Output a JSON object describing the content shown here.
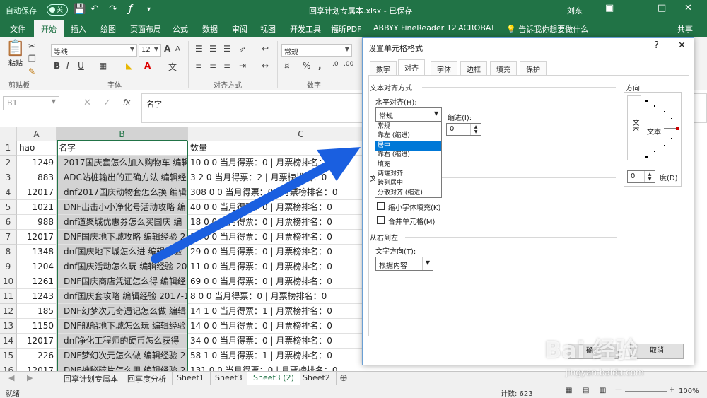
{
  "titlebar": {
    "autosave": "自动保存",
    "toggle": "关",
    "doc_title": "回享计划专属本.xlsx - 已保存",
    "user": "刘东",
    "icons": [
      "save-icon",
      "undo-icon",
      "redo-icon",
      "fx-icon",
      "customize-qat-icon"
    ]
  },
  "tabs": [
    "文件",
    "开始",
    "插入",
    "绘图",
    "页面布局",
    "公式",
    "数据",
    "审阅",
    "视图",
    "开发工具",
    "福昕PDF",
    "ABBYY FineReader 12",
    "ACROBAT"
  ],
  "tell_me": "告诉我你想要做什么",
  "share": "共享",
  "ribbon": {
    "paste": "粘贴",
    "clipboard": "剪贴板",
    "font_name": "等线",
    "font_size": "12",
    "font_group": "字体",
    "align_group": "对齐方式",
    "number_format": "常规",
    "number_group": "数字",
    "bold": "B",
    "italic": "I",
    "underline": "U",
    "font_a": "A",
    "wen": "文",
    "percent": "%",
    "comma": ","
  },
  "formula_bar": {
    "name_box": "B1",
    "fx": "fx",
    "content": "名字"
  },
  "grid": {
    "columns": [
      "A",
      "B",
      "C"
    ],
    "rows": [
      {
        "n": "1",
        "a": "hao",
        "b": "名字",
        "c": "数量"
      },
      {
        "n": "2",
        "a": "1249",
        "b": "2017国庆套怎么加入购物车 编辑",
        "c": "10 0 0 当月得票：0 | 月票榜排名：0"
      },
      {
        "n": "3",
        "a": "883",
        "b": "ADC站桩输出的正确方法 编辑经",
        "c": "3 2 0 当月得票：2 | 月票榜排名：0"
      },
      {
        "n": "4",
        "a": "12017",
        "b": "dnf2017国庆动物套怎么换 编辑",
        "c": "308 0 0 当月得票：0 | 月票榜排名：0"
      },
      {
        "n": "5",
        "a": "1021",
        "b": "DNF出击小小净化号活动攻略 编",
        "c": "40 0 0 当月得票：0 | 月票榜排名：0"
      },
      {
        "n": "6",
        "a": "988",
        "b": "dnf道聚城优惠券怎么买国庆 编",
        "c": "18 0 0 当月得票：0 | 月票榜排名：0"
      },
      {
        "n": "7",
        "a": "12017",
        "b": "DNF国庆地下城攻略 编辑经验 2",
        "c": "12 0 0 当月得票：0 | 月票榜排名：0"
      },
      {
        "n": "8",
        "a": "1348",
        "b": "dnf国庆地下城怎么进 编辑经验",
        "c": "29 0 0 当月得票：0 | 月票榜排名：0"
      },
      {
        "n": "9",
        "a": "1204",
        "b": "dnf国庆活动怎么玩 编辑经验 20",
        "c": "11 0 0 当月得票：0 | 月票榜排名：0"
      },
      {
        "n": "10",
        "a": "1261",
        "b": "DNF国庆商店凭证怎么得 编辑经",
        "c": "69 0 0 当月得票：0 | 月票榜排名：0"
      },
      {
        "n": "11",
        "a": "1243",
        "b": "dnf国庆套攻略 编辑经验 2017-1",
        "c": "8 0 0 当月得票：0 | 月票榜排名：0"
      },
      {
        "n": "12",
        "a": "185",
        "b": "DNF幻梦次元奇遇记怎么做 编辑",
        "c": "14 1 0 当月得票：1 | 月票榜排名：0"
      },
      {
        "n": "13",
        "a": "1150",
        "b": "DNF舰船地下城怎么玩 编辑经验",
        "c": "14 0 0 当月得票：0 | 月票榜排名：0"
      },
      {
        "n": "14",
        "a": "12017",
        "b": "dnf净化工程师的硬币怎么获得",
        "c": "34 0 0 当月得票：0 | 月票榜排名：0"
      },
      {
        "n": "15",
        "a": "226",
        "b": "DNF梦幻次元怎么做 编辑经验 2",
        "c": "58 1 0 当月得票：1 | 月票榜排名：0"
      },
      {
        "n": "16",
        "a": "12017",
        "b": "DNF神秘碎片怎么用 编辑经验 2",
        "c": "131 0 0 当月得票：0 | 月票榜排名：0"
      }
    ]
  },
  "sheets": [
    "回享计划专属本",
    "回享度分析",
    "Sheet1",
    "Sheet3",
    "Sheet3 (2)",
    "Sheet2"
  ],
  "active_sheet": "Sheet3 (2)",
  "status": {
    "mode": "就绪",
    "count": "计数: 623",
    "zoom": "100%"
  },
  "dialog": {
    "title": "设置单元格格式",
    "help": "?",
    "close": "✕",
    "tabs": [
      "数字",
      "对齐",
      "字体",
      "边框",
      "填充",
      "保护"
    ],
    "active_tab": "对齐",
    "text_alignment": "文本对齐方式",
    "horizontal_label": "水平对齐(H):",
    "horizontal_value": "常规",
    "indent_label": "缩进(I):",
    "indent_value": "0",
    "dropdown_items": [
      "常规",
      "靠左 (缩进)",
      "居中",
      "靠右 (缩进)",
      "填充",
      "两端对齐",
      "跨列居中",
      "分散对齐 (缩进)"
    ],
    "highlighted_item": "居中",
    "text_control_short": "文",
    "shrink_label": "缩小字体填充(K)",
    "merge_label": "合并单元格(M)",
    "rtl_section": "从右到左",
    "direction_label": "文字方向(T):",
    "direction_value": "根据内容",
    "orientation_section": "方向",
    "orientation_vertical": "文本",
    "orientation_text": "文本",
    "degrees_value": "0",
    "degrees_label": "度(D)",
    "ok": "确定",
    "cancel": "取消"
  },
  "watermark": {
    "main": "Bai 经验",
    "sub": "jingyan.baidu.com"
  },
  "colors": {
    "excel_green": "#217346",
    "arrow_blue": "#1a5fe0",
    "highlight": "#0078d7"
  }
}
